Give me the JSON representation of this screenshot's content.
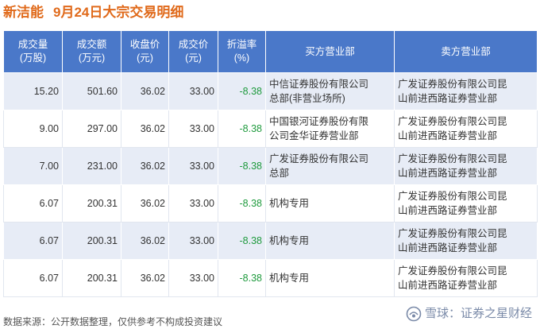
{
  "header": {
    "company": "新洁能",
    "subtitle": "9月24日大宗交易明细"
  },
  "table": {
    "columns": [
      {
        "line1": "成交量",
        "line2": "(万股)"
      },
      {
        "line1": "成交额",
        "line2": "(万元)"
      },
      {
        "line1": "收盘价",
        "line2": "(元)"
      },
      {
        "line1": "成交价",
        "line2": "(元)"
      },
      {
        "line1": "折溢率",
        "line2": "(%)"
      },
      {
        "line1": "买方营业部",
        "line2": ""
      },
      {
        "line1": "卖方营业部",
        "line2": ""
      }
    ],
    "rows": [
      {
        "volume": "15.20",
        "amount": "501.60",
        "close": "36.02",
        "price": "33.00",
        "premium": "-8.38",
        "buyer_l1": "中信证券股份有限公司",
        "buyer_l2": "总部(非营业场所)",
        "seller_l1": "广发证券股份有限公司昆",
        "seller_l2": "山前进西路证券营业部"
      },
      {
        "volume": "9.00",
        "amount": "297.00",
        "close": "36.02",
        "price": "33.00",
        "premium": "-8.38",
        "buyer_l1": "中国银河证券股份有限",
        "buyer_l2": "公司金华证券营业部",
        "seller_l1": "广发证券股份有限公司昆",
        "seller_l2": "山前进西路证券营业部"
      },
      {
        "volume": "7.00",
        "amount": "231.00",
        "close": "36.02",
        "price": "33.00",
        "premium": "-8.38",
        "buyer_l1": "广发证券股份有限公司",
        "buyer_l2": "总部",
        "seller_l1": "广发证券股份有限公司昆",
        "seller_l2": "山前进西路证券营业部"
      },
      {
        "volume": "6.07",
        "amount": "200.31",
        "close": "36.02",
        "price": "33.00",
        "premium": "-8.38",
        "buyer_l1": "机构专用",
        "buyer_l2": "",
        "seller_l1": "广发证券股份有限公司昆",
        "seller_l2": "山前进西路证券营业部"
      },
      {
        "volume": "6.07",
        "amount": "200.31",
        "close": "36.02",
        "price": "33.00",
        "premium": "-8.38",
        "buyer_l1": "机构专用",
        "buyer_l2": "",
        "seller_l1": "广发证券股份有限公司昆",
        "seller_l2": "山前进西路证券营业部"
      },
      {
        "volume": "6.07",
        "amount": "200.31",
        "close": "36.02",
        "price": "33.00",
        "premium": "-8.38",
        "buyer_l1": "机构专用",
        "buyer_l2": "",
        "seller_l1": "广发证券股份有限公司昆",
        "seller_l2": "山前进西路证券营业部"
      }
    ]
  },
  "footer": {
    "source": "数据来源：公开数据整理，仅供参考不构成投资建议"
  },
  "brand": {
    "text": "雪球：证券之星财经",
    "icon": "snowball-icon"
  },
  "watermark": {
    "text": "证券之星"
  },
  "colors": {
    "title": "#e06a1b",
    "header_bg": "#4a78c9",
    "row_alt_bg": "#e7ecf6",
    "negative": "#1e9a3d"
  }
}
